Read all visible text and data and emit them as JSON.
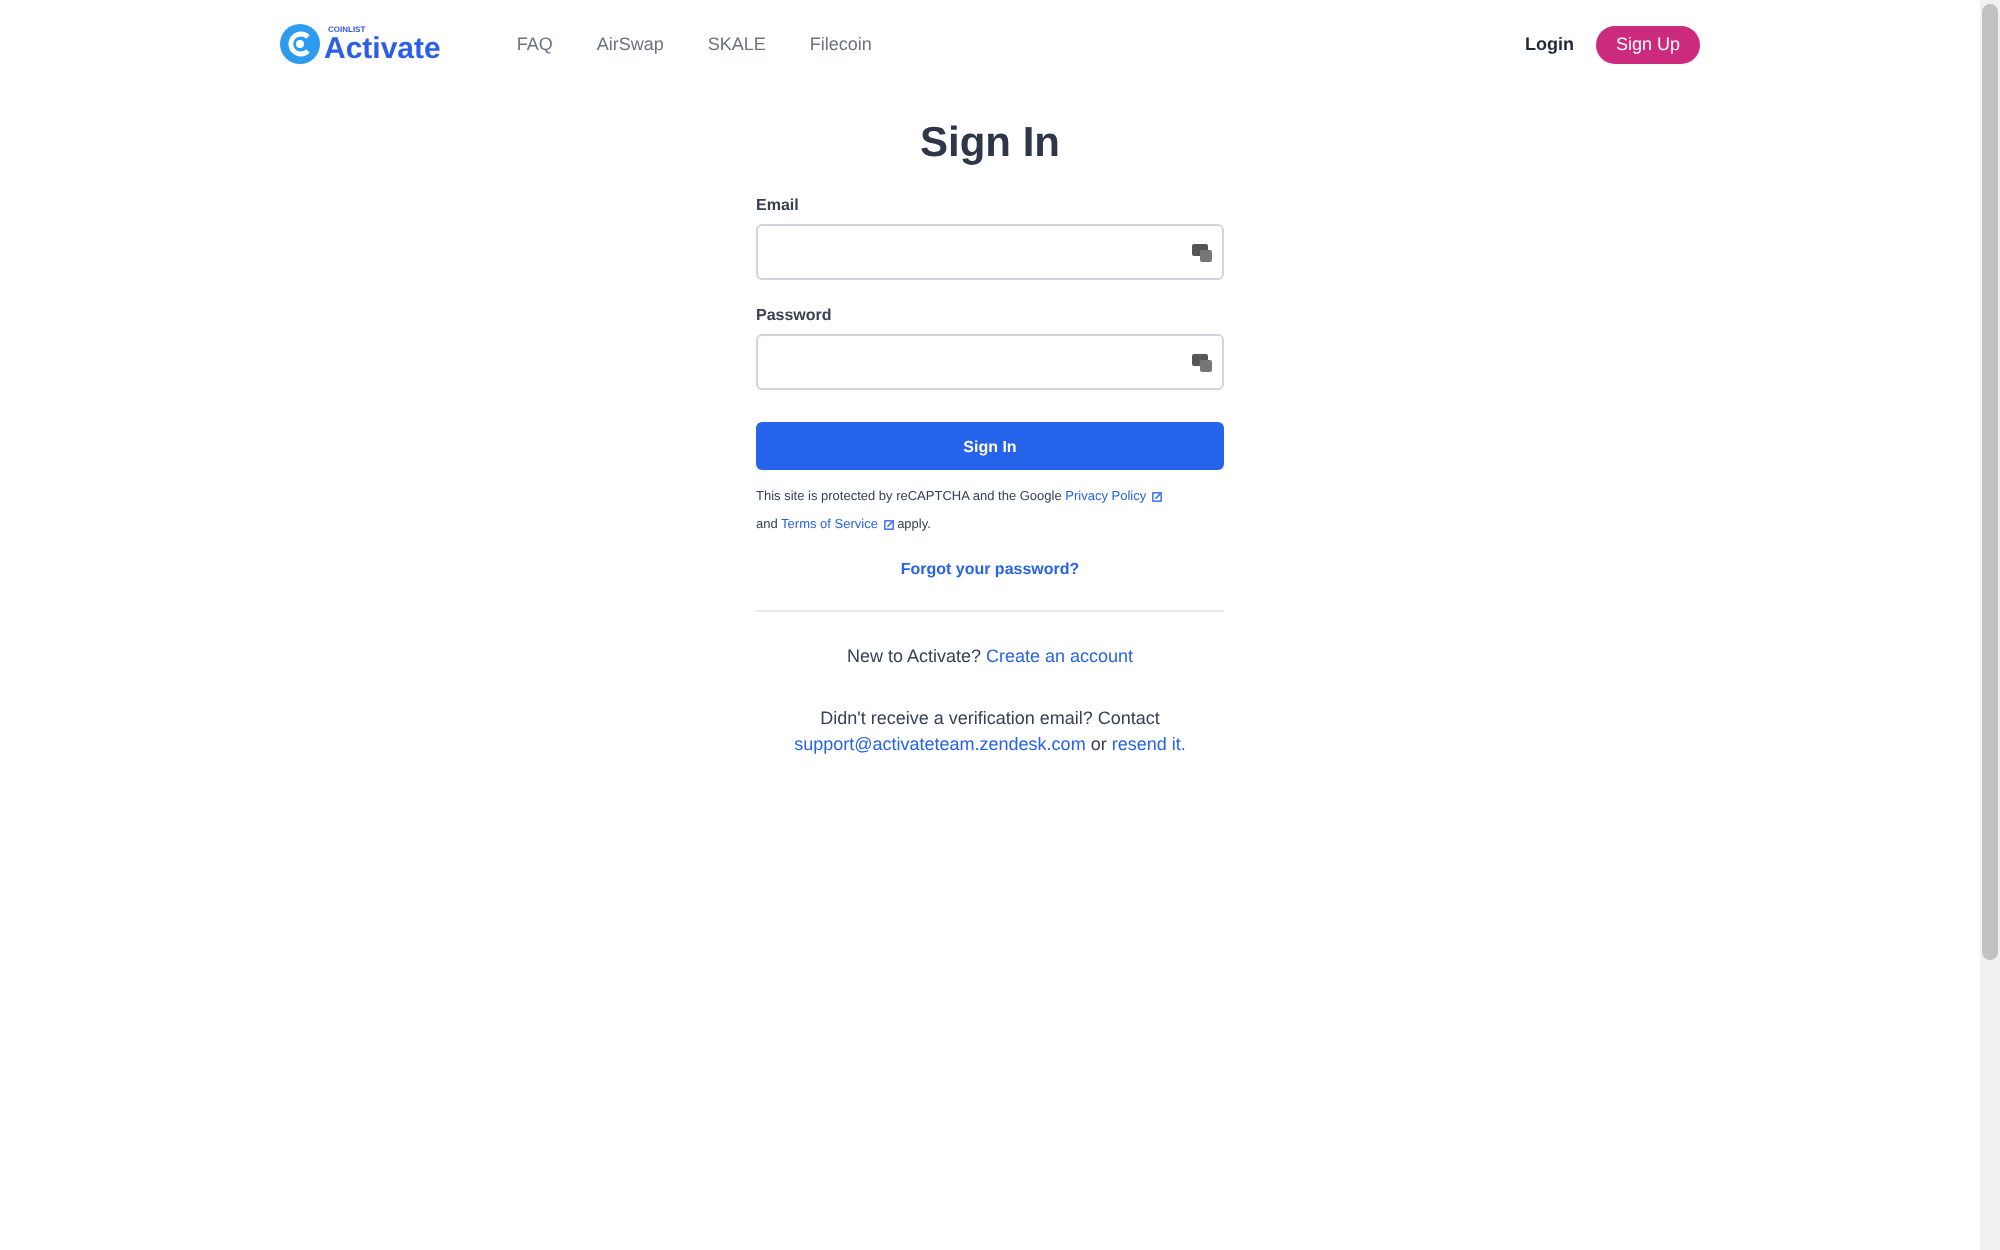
{
  "header": {
    "logo": {
      "small": "COINLIST",
      "name": "Activate"
    },
    "nav": [
      "FAQ",
      "AirSwap",
      "SKALE",
      "Filecoin"
    ],
    "login": "Login",
    "signup": "Sign Up"
  },
  "form": {
    "title": "Sign In",
    "fields": [
      {
        "label": "Email"
      },
      {
        "label": "Password"
      }
    ],
    "submit": "Sign In",
    "recaptcha": {
      "before": "This site is protected by reCAPTCHA and the Google",
      "privacy": "Privacy Policy",
      "middle": "and",
      "terms": "Terms of Service",
      "after": "apply."
    },
    "forgot": "Forgot your password?",
    "new_account": {
      "text": "New to Activate?",
      "link": "Create an account"
    },
    "verification": {
      "text": "Didn't receive a verification email? Contact",
      "email": "support@activateteam.zendesk.com",
      "middle": "or",
      "link": "resend it."
    }
  }
}
